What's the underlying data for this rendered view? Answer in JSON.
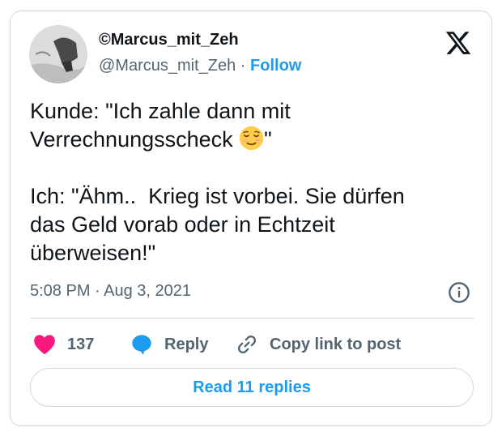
{
  "author": {
    "display_name": "©Marcus_mit_Zeh",
    "handle": "@Marcus_mit_Zeh",
    "separator": " · ",
    "follow_label": "Follow",
    "avatar_icon": "avatar-photo"
  },
  "platform_icon": "x-logo-icon",
  "tweet": {
    "line1": "Kunde: \"Ich zahle dann mit",
    "line2_before_emoji": "Verrechnungsscheck ",
    "emoji": "relieved-face-emoji",
    "line2_after_emoji": "\"",
    "paragraph2": "Ich: \"Ähm..  Krieg ist vorbei. Sie dürfen\ndas Geld vorab oder in Echtzeit\nüberweisen!\""
  },
  "meta": {
    "timestamp": "5:08 PM · Aug 3, 2021",
    "info_icon": "info-icon"
  },
  "actions": {
    "like_count": "137",
    "reply_label": "Reply",
    "copy_link_label": "Copy link to post"
  },
  "read_replies_label": "Read 11 replies",
  "colors": {
    "like": "#f91880",
    "reply": "#1d9bf0",
    "link": "#1d9bf0",
    "secondary_text": "#536471",
    "border": "#cfd9de"
  }
}
